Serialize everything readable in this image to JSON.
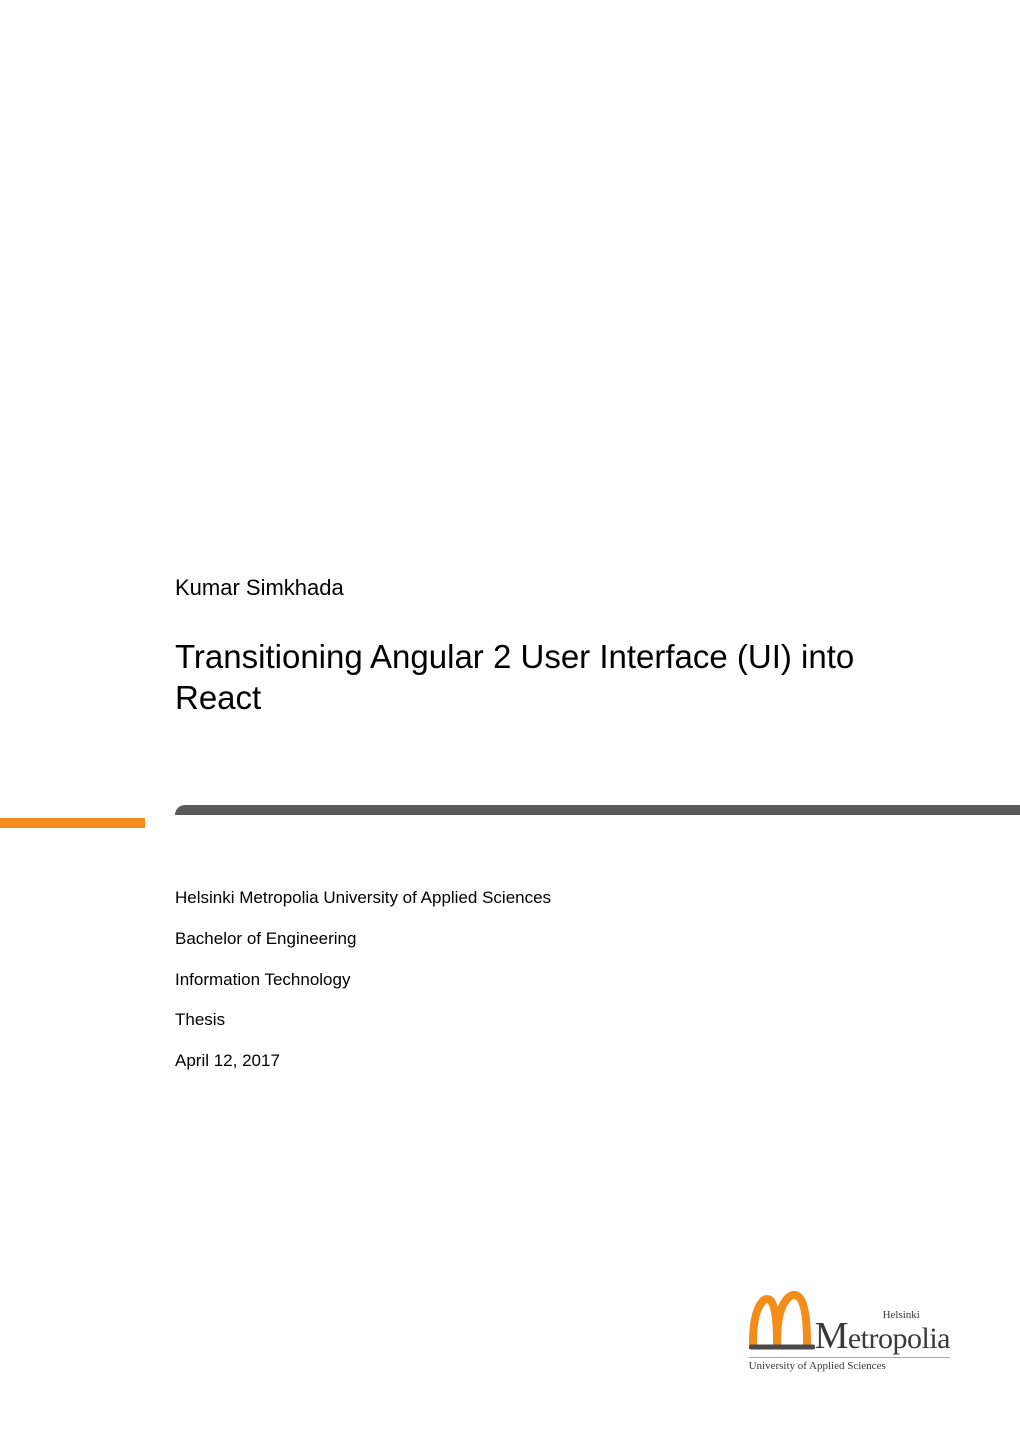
{
  "author": "Kumar Simkhada",
  "title": "Transitioning Angular 2 User Interface (UI) into React",
  "meta": {
    "institution": "Helsinki Metropolia University of Applied Sciences",
    "degree": "Bachelor of Engineering",
    "program": "Information Technology",
    "doctype": "Thesis",
    "date": "April 12, 2017"
  },
  "logo": {
    "prefix": "Helsinki",
    "main": "Metropolia",
    "subtitle": "University of Applied Sciences"
  },
  "colors": {
    "accent": "#f28c1a",
    "bar": "#5a5a5a"
  }
}
